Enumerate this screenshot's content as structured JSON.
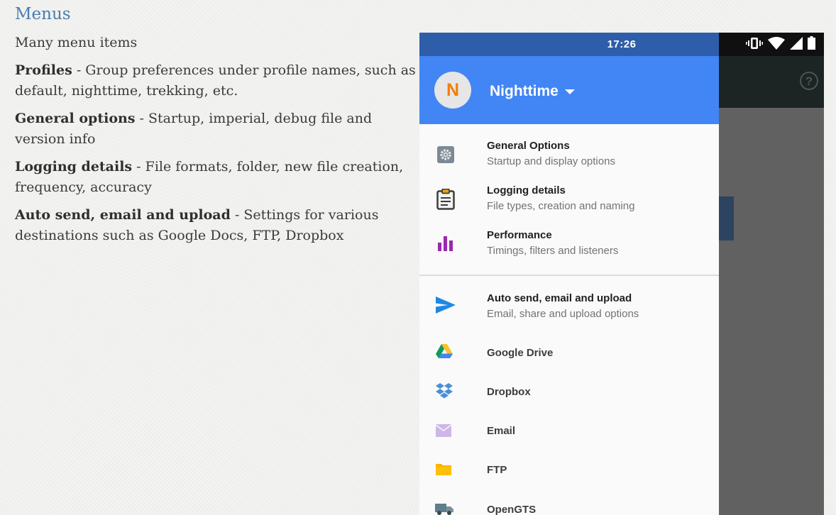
{
  "slide": {
    "title": "Menus",
    "notes": [
      {
        "bold": "",
        "text": "Many menu items"
      },
      {
        "bold": "Profiles",
        "text": " - Group preferences under profile names, such as default, nighttime, trekking, etc."
      },
      {
        "bold": "General options",
        "text": " - Startup, imperial, debug file and version info"
      },
      {
        "bold": "Logging details",
        "text": " - File formats, folder, new file creation, frequency, accuracy"
      },
      {
        "bold": "Auto send, email and upload",
        "text": " - Settings for various destinations such as Google Docs, FTP, Dropbox"
      }
    ]
  },
  "phone": {
    "status_time": "17:26",
    "help_glyph": "?",
    "drawer": {
      "avatar_letter": "N",
      "profile_name": "Nighttime",
      "items": [
        {
          "title": "General Options",
          "subtitle": "Startup and display options",
          "icon": "gear-icon"
        },
        {
          "title": "Logging details",
          "subtitle": "File types, creation and naming",
          "icon": "clipboard-icon"
        },
        {
          "title": "Performance",
          "subtitle": "Timings, filters and listeners",
          "icon": "bar-chart-icon"
        },
        {
          "title": "Auto send, email and upload",
          "subtitle": "Email, share and upload options",
          "icon": "send-icon"
        }
      ],
      "destinations": [
        {
          "label": "Google Drive",
          "icon": "google-drive-icon"
        },
        {
          "label": "Dropbox",
          "icon": "dropbox-icon"
        },
        {
          "label": "Email",
          "icon": "email-icon"
        },
        {
          "label": "FTP",
          "icon": "folder-icon"
        },
        {
          "label": "OpenGTS",
          "icon": "truck-icon"
        }
      ]
    },
    "colors": {
      "status_bar": "#2e5ea9",
      "drawer_header": "#4285f4",
      "avatar_letter": "#f57c00",
      "drawer_background": "#fafafa",
      "scrim": "#616161"
    }
  }
}
